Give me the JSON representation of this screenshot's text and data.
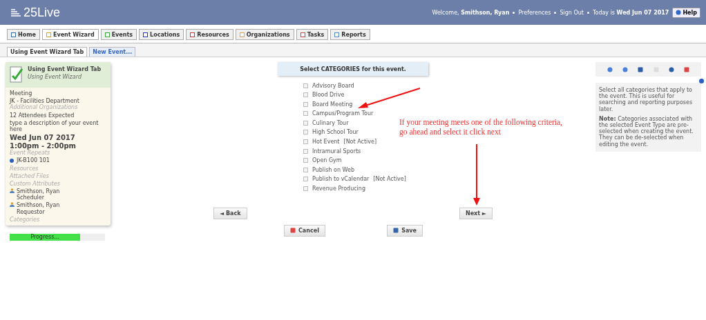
{
  "header": {
    "logo": "25Live",
    "welcome": "Welcome,",
    "user": "Smithson, Ryan",
    "links": [
      "Preferences",
      "Sign Out"
    ],
    "today_label": "Today is",
    "today": "Wed Jun 07 2017",
    "help": "Help"
  },
  "tabs": [
    {
      "label": "Home",
      "selected": false
    },
    {
      "label": "Event Wizard",
      "selected": true
    },
    {
      "label": "Events",
      "selected": false
    },
    {
      "label": "Locations",
      "selected": false
    },
    {
      "label": "Resources",
      "selected": false
    },
    {
      "label": "Organizations",
      "selected": false
    },
    {
      "label": "Tasks",
      "selected": false
    },
    {
      "label": "Reports",
      "selected": false
    }
  ],
  "subtabs": [
    {
      "label": "Using Event Wizard Tab",
      "selected": true
    },
    {
      "label": "New Event...",
      "selected": false
    }
  ],
  "summary": {
    "title": "Using Event Wizard Tab",
    "subtitle": "Using Event Wizard",
    "type": "Meeting",
    "organization": "JK - Facilities Department",
    "additional_orgs": "Additional Organizations",
    "attendees": "12 Attendees Expected",
    "description": "type a description of your event here",
    "date": "Wed Jun 07 2017",
    "time": "1:00pm - 2:00pm",
    "repeats": "Event Repeats",
    "location": "JK-B100 101",
    "resources": "Resources",
    "files": "Attached Files",
    "attributes": "Custom Attributes",
    "contacts": [
      {
        "name": "Smithson, Ryan",
        "role": "Scheduler"
      },
      {
        "name": "Smithson, Ryan",
        "role": "Requestor"
      }
    ],
    "categories": "Categories"
  },
  "progress": {
    "label": "Progress...",
    "level": 0.74
  },
  "step_title": "Select CATEGORIES for this event.",
  "categories": [
    {
      "label": "Advisory Board",
      "checked": false
    },
    {
      "label": "Blood Drive",
      "checked": false
    },
    {
      "label": "Board Meeting",
      "checked": false
    },
    {
      "label": "Campus/Program Tour",
      "checked": false
    },
    {
      "label": "Culinary Tour",
      "checked": false
    },
    {
      "label": "High School Tour",
      "checked": false
    },
    {
      "label": "Hot Event",
      "checked": false,
      "note": "[Not Active]"
    },
    {
      "label": "Intramural Sports",
      "checked": false
    },
    {
      "label": "Open Gym",
      "checked": false
    },
    {
      "label": "Publish on Web",
      "checked": false
    },
    {
      "label": "Publish to vCalendar",
      "checked": false,
      "note": "[Not Active]"
    },
    {
      "label": "Revenue Producing",
      "checked": false
    }
  ],
  "buttons": {
    "back": "◄ Back",
    "next": "Next ►",
    "cancel": "Cancel",
    "save": "Save"
  },
  "help_text": "Select all categories that apply to the event. This is useful for searching and reporting purposes later.",
  "help_note": "**Note:** Categories associated with the selected Event Type are pre-selected when creating the event. They can be de-selected when editing the event.",
  "annotation": "If your meeting meets one of the following criteria, go ahead and select it click next"
}
